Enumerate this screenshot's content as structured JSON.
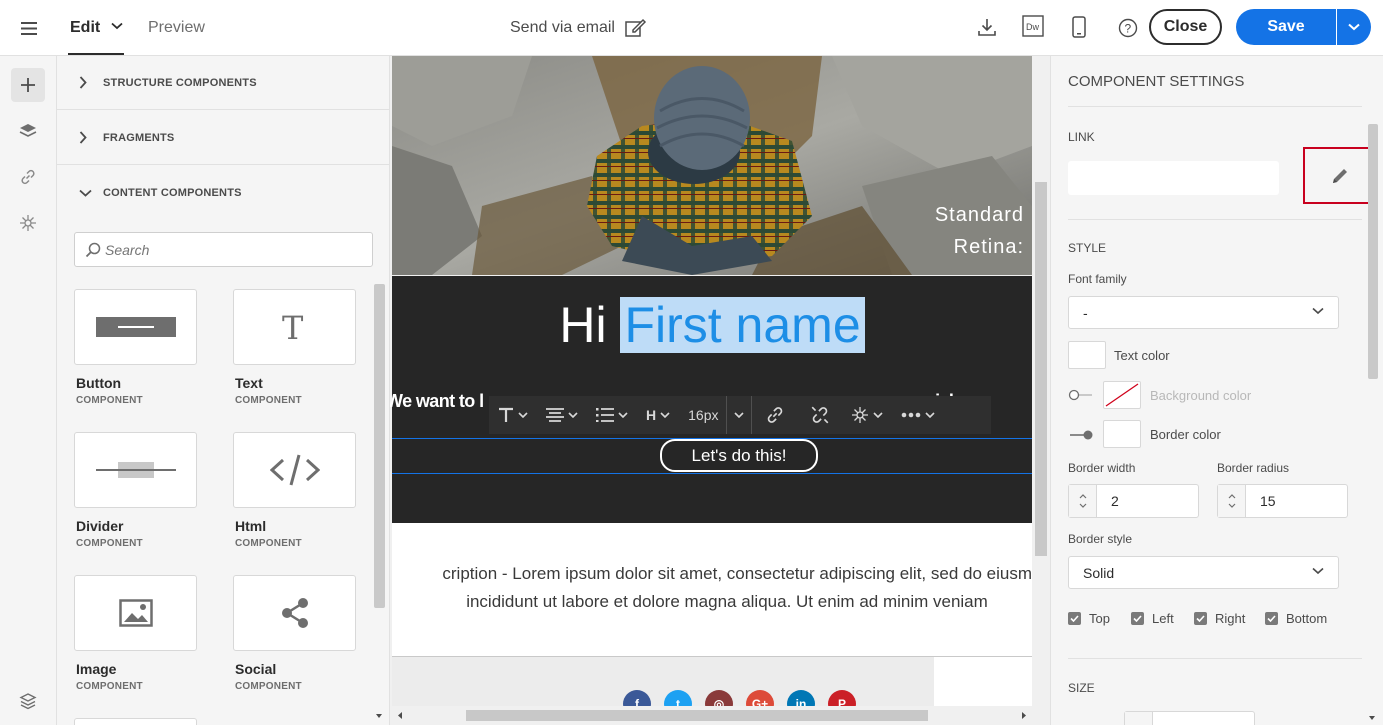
{
  "topbar": {
    "tabs": {
      "edit": "Edit",
      "preview": "Preview"
    },
    "send_via_email": "Send via email",
    "close_label": "Close",
    "save_label": "Save"
  },
  "component_panel": {
    "sections": [
      "STRUCTURE COMPONENTS",
      "FRAGMENTS",
      "CONTENT COMPONENTS"
    ],
    "search_placeholder": "Search",
    "components": [
      {
        "name": "Button",
        "type": "COMPONENT",
        "icon": "button-icon"
      },
      {
        "name": "Text",
        "type": "COMPONENT",
        "icon": "text-icon"
      },
      {
        "name": "Divider",
        "type": "COMPONENT",
        "icon": "divider-icon"
      },
      {
        "name": "Html",
        "type": "COMPONENT",
        "icon": "code-icon"
      },
      {
        "name": "Image",
        "type": "COMPONENT",
        "icon": "image-icon"
      },
      {
        "name": "Social",
        "type": "COMPONENT",
        "icon": "share-icon"
      }
    ]
  },
  "canvas": {
    "hero_text_1": "Standard",
    "hero_text_2": "Retina:",
    "greeting_prefix": "Hi",
    "greeting_name": "First name",
    "subline_left": "We want to l",
    "subline_right": "ecial o",
    "toolbar": {
      "font_size": "16px",
      "heading": "H"
    },
    "cta_label": "Let's do this!",
    "description_line1": "cription - Lorem ipsum dolor sit amet, consectetur adipiscing elit, sed do eiusm",
    "description_line2": "incididunt ut labore et dolore magna aliqua. Ut enim ad minim veniam",
    "social_icons": [
      {
        "name": "facebook-icon",
        "glyph": "f",
        "color": "#3b5998"
      },
      {
        "name": "twitter-icon",
        "glyph": "t",
        "color": "#1da1f2"
      },
      {
        "name": "instagram-icon",
        "glyph": "◎",
        "color": "#8a3a3a"
      },
      {
        "name": "googleplus-icon",
        "glyph": "G+",
        "color": "#dd4b39"
      },
      {
        "name": "linkedin-icon",
        "glyph": "in",
        "color": "#0077b5"
      },
      {
        "name": "pinterest-icon",
        "glyph": "P",
        "color": "#cb2027"
      }
    ]
  },
  "settings": {
    "title": "COMPONENT SETTINGS",
    "link_label": "LINK",
    "style_label": "STYLE",
    "font_family_label": "Font family",
    "font_family_value": "-",
    "text_color_label": "Text color",
    "background_color_label": "Background color",
    "border_color_label": "Border color",
    "border_width_label": "Border width",
    "border_width_value": "2",
    "border_radius_label": "Border radius",
    "border_radius_value": "15",
    "border_style_label": "Border style",
    "border_style_value": "Solid",
    "sides": [
      "Top",
      "Left",
      "Right",
      "Bottom"
    ],
    "size_label": "SIZE"
  },
  "colors": {
    "accent": "#1473e6",
    "dark_section": "#262626",
    "highlight": "#bedcf7",
    "focus_red": "#c8001e"
  }
}
